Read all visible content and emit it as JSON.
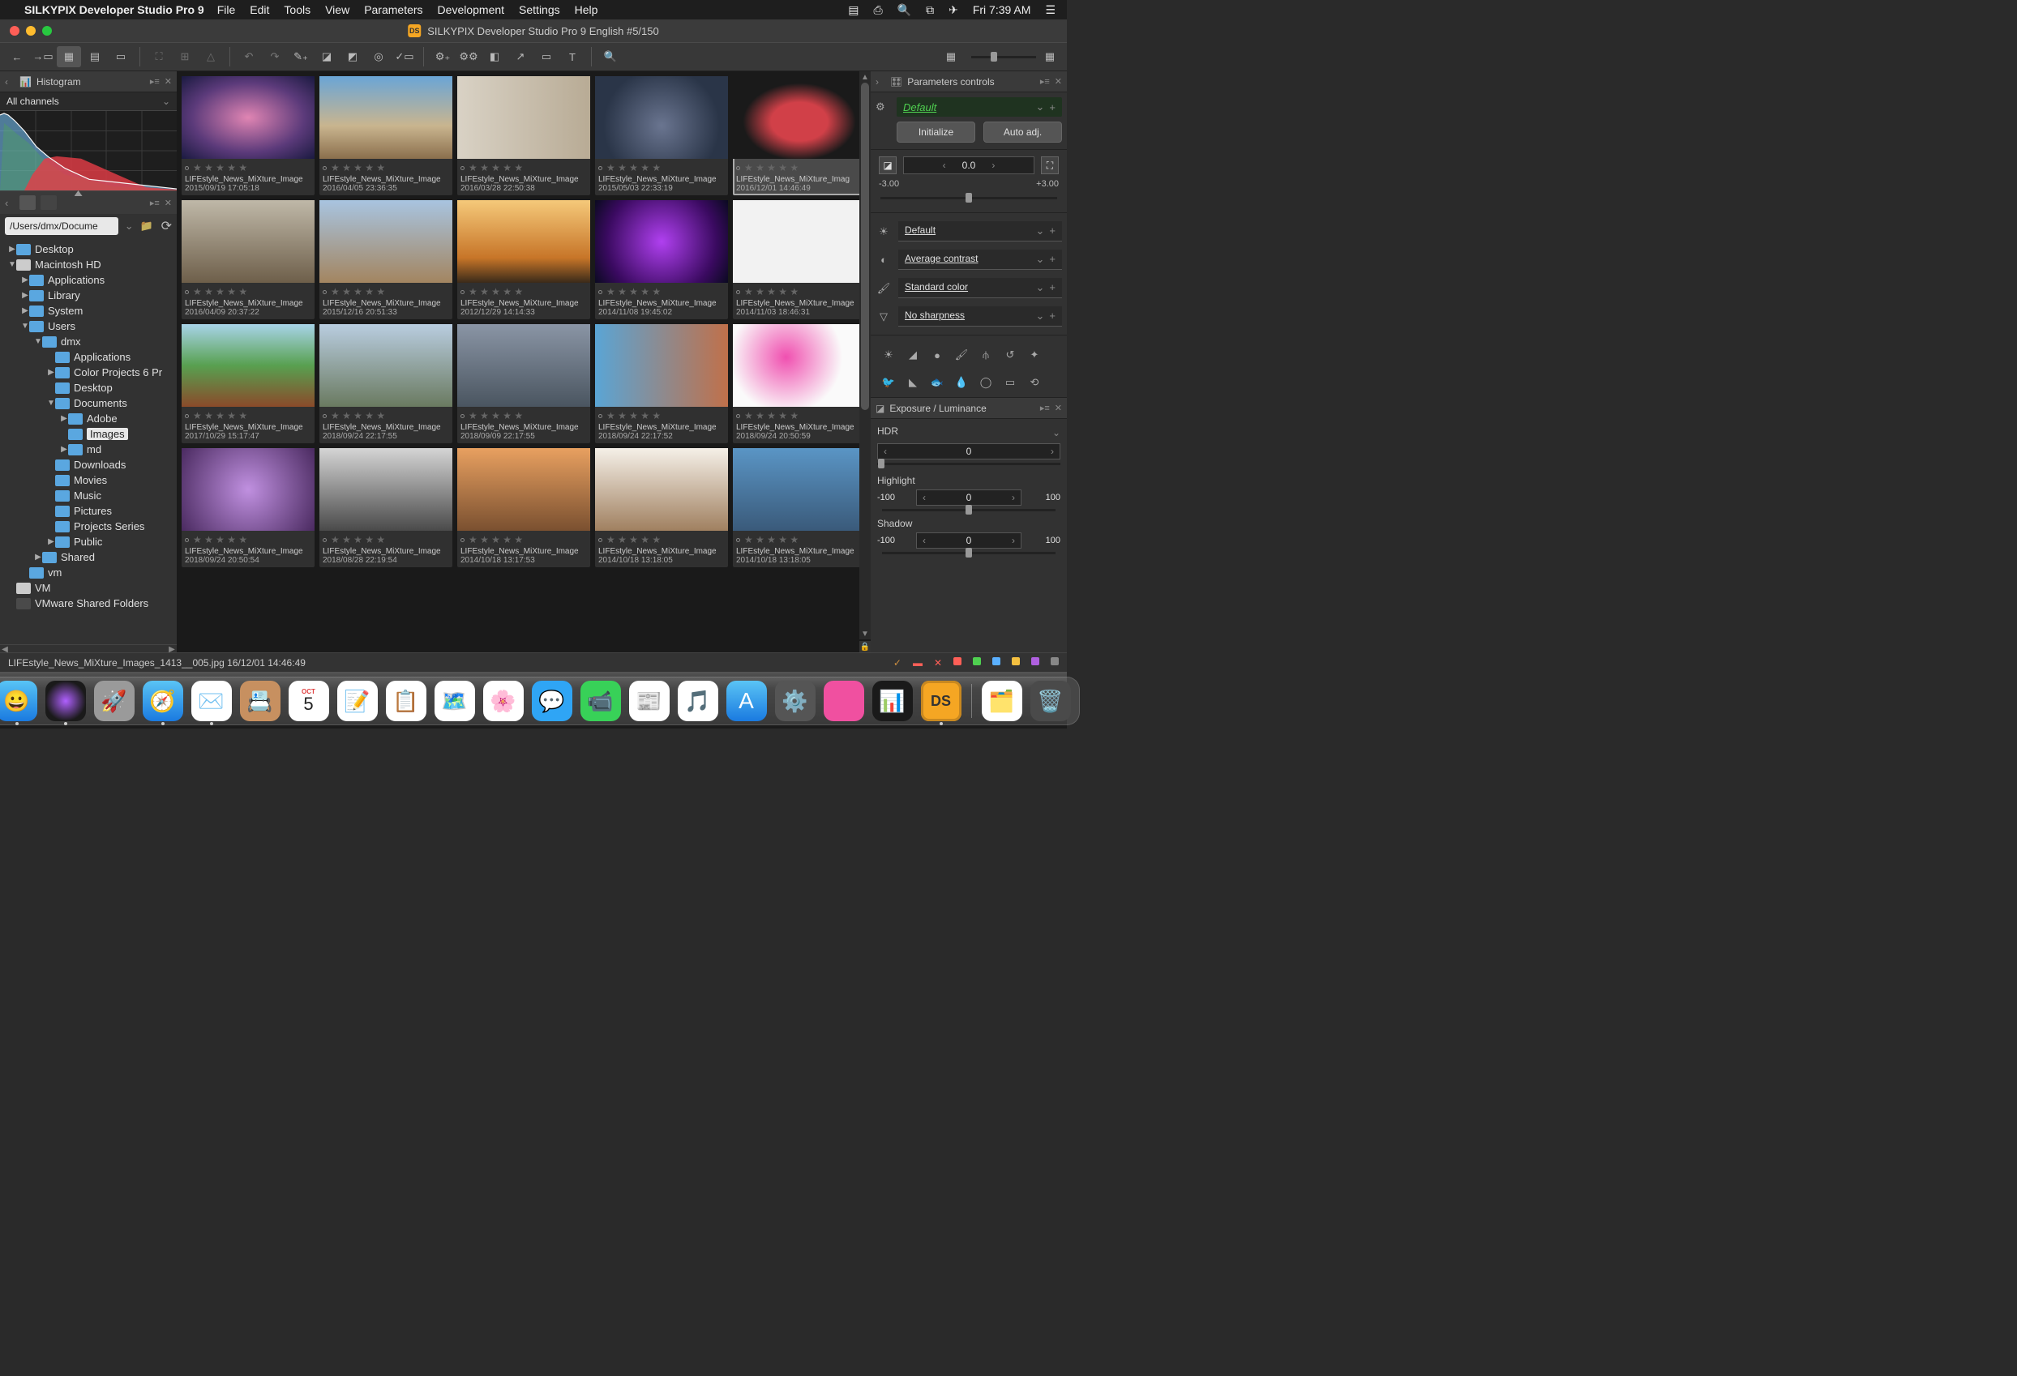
{
  "menubar": {
    "app_name": "SILKYPIX Developer Studio Pro 9",
    "menus": [
      "File",
      "Edit",
      "Tools",
      "View",
      "Parameters",
      "Development",
      "Settings",
      "Help"
    ],
    "clock": "Fri 7:39 AM"
  },
  "window": {
    "ds_badge": "DS",
    "title": "SILKYPIX Developer Studio Pro 9 English   #5/150"
  },
  "histogram": {
    "title": "Histogram",
    "channel": "All channels"
  },
  "browser": {
    "path": "/Users/dmx/Docume",
    "tree": [
      {
        "d": 0,
        "tri": "▶",
        "icon": "folder",
        "label": "Desktop"
      },
      {
        "d": 0,
        "tri": "▼",
        "icon": "hd",
        "label": "Macintosh HD"
      },
      {
        "d": 1,
        "tri": "▶",
        "icon": "folder",
        "label": "Applications"
      },
      {
        "d": 1,
        "tri": "▶",
        "icon": "folder",
        "label": "Library"
      },
      {
        "d": 1,
        "tri": "▶",
        "icon": "folder",
        "label": "System"
      },
      {
        "d": 1,
        "tri": "▼",
        "icon": "folder",
        "label": "Users"
      },
      {
        "d": 2,
        "tri": "▼",
        "icon": "folder",
        "label": "dmx"
      },
      {
        "d": 3,
        "tri": "",
        "icon": "folder",
        "label": "Applications"
      },
      {
        "d": 3,
        "tri": "▶",
        "icon": "folder",
        "label": "Color Projects 6 Pr"
      },
      {
        "d": 3,
        "tri": "",
        "icon": "folder",
        "label": "Desktop"
      },
      {
        "d": 3,
        "tri": "▼",
        "icon": "folder",
        "label": "Documents"
      },
      {
        "d": 4,
        "tri": "▶",
        "icon": "folder",
        "label": "Adobe"
      },
      {
        "d": 4,
        "tri": "",
        "icon": "folder",
        "label": "Images",
        "sel": true
      },
      {
        "d": 4,
        "tri": "▶",
        "icon": "folder",
        "label": "md"
      },
      {
        "d": 3,
        "tri": "",
        "icon": "folder",
        "label": "Downloads"
      },
      {
        "d": 3,
        "tri": "",
        "icon": "folder",
        "label": "Movies"
      },
      {
        "d": 3,
        "tri": "",
        "icon": "folder",
        "label": "Music"
      },
      {
        "d": 3,
        "tri": "",
        "icon": "folder",
        "label": "Pictures"
      },
      {
        "d": 3,
        "tri": "",
        "icon": "folder",
        "label": "Projects Series"
      },
      {
        "d": 3,
        "tri": "▶",
        "icon": "folder",
        "label": "Public"
      },
      {
        "d": 2,
        "tri": "▶",
        "icon": "folder",
        "label": "Shared"
      },
      {
        "d": 1,
        "tri": "",
        "icon": "folder",
        "label": "vm"
      },
      {
        "d": 0,
        "tri": "",
        "icon": "hd",
        "label": "VM"
      },
      {
        "d": 0,
        "tri": "",
        "icon": "dark",
        "label": "VMware Shared Folders"
      }
    ]
  },
  "thumbs": [
    {
      "g": "g1",
      "name": "LIFEstyle_News_MiXture_Image",
      "date": "2015/09/19 17:05:18"
    },
    {
      "g": "g2",
      "name": "LIFEstyle_News_MiXture_Image",
      "date": "2016/04/05 23:36:35"
    },
    {
      "g": "g3",
      "name": "LIFEstyle_News_MiXture_Image",
      "date": "2016/03/28 22:50:38"
    },
    {
      "g": "g4",
      "name": "LIFEstyle_News_MiXture_Image",
      "date": "2015/05/03 22:33:19"
    },
    {
      "g": "g5",
      "name": "LIFEstyle_News_MiXture_Imag",
      "date": "2016/12/01 14:46:49",
      "sel": true
    },
    {
      "g": "g6",
      "name": "LIFEstyle_News_MiXture_Image",
      "date": "2016/04/09 20:37:22"
    },
    {
      "g": "g7",
      "name": "LIFEstyle_News_MiXture_Image",
      "date": "2015/12/16 20:51:33"
    },
    {
      "g": "g8",
      "name": "LIFEstyle_News_MiXture_Image",
      "date": "2012/12/29 14:14:33"
    },
    {
      "g": "g9",
      "name": "LIFEstyle_News_MiXture_Image",
      "date": "2014/11/08 19:45:02"
    },
    {
      "g": "g10",
      "name": "LIFEstyle_News_MiXture_Image",
      "date": "2014/11/03 18:46:31"
    },
    {
      "g": "g11",
      "name": "LIFEstyle_News_MiXture_Image",
      "date": "2017/10/29 15:17:47"
    },
    {
      "g": "g12",
      "name": "LIFEstyle_News_MiXture_Image",
      "date": "2018/09/24 22:17:55"
    },
    {
      "g": "g13",
      "name": "LIFEstyle_News_MiXture_Image",
      "date": "2018/09/09 22:17:55"
    },
    {
      "g": "g14",
      "name": "LIFEstyle_News_MiXture_Image",
      "date": "2018/09/24 22:17:52"
    },
    {
      "g": "g15",
      "name": "LIFEstyle_News_MiXture_Image",
      "date": "2018/09/24 20:50:59"
    },
    {
      "g": "g16",
      "name": "LIFEstyle_News_MiXture_Image",
      "date": "2018/09/24 20:50:54"
    },
    {
      "g": "g17",
      "name": "LIFEstyle_News_MiXture_Image",
      "date": "2018/08/28 22:19:54"
    },
    {
      "g": "g18",
      "name": "LIFEstyle_News_MiXture_Image",
      "date": "2014/10/18 13:17:53"
    },
    {
      "g": "g19",
      "name": "LIFEstyle_News_MiXture_Image",
      "date": "2014/10/18 13:18:05"
    },
    {
      "g": "g20",
      "name": "LIFEstyle_News_MiXture_Image",
      "date": "2014/10/18 13:18:05"
    }
  ],
  "params": {
    "title": "Parameters controls",
    "preset": "Default",
    "initialize": "Initialize",
    "auto_adj": "Auto adj.",
    "exp_value": "0.0",
    "exp_min": "-3.00",
    "exp_max": "+3.00",
    "wb": "Default",
    "tone": "Average contrast",
    "color": "Standard color",
    "sharp": "No sharpness"
  },
  "exposure": {
    "title": "Exposure / Luminance",
    "hdr": "HDR",
    "hdr_val": "0",
    "highlight": "Highlight",
    "hl_min": "-100",
    "hl_val": "0",
    "hl_max": "100",
    "shadow": "Shadow",
    "sh_min": "-100",
    "sh_val": "0",
    "sh_max": "100"
  },
  "status": {
    "text": "LIFEstyle_News_MiXture_Images_1413__005.jpg 16/12/01 14:46:49",
    "colors": [
      "#ff5f57",
      "#4fd050",
      "#5ab0ff",
      "#f5c040",
      "#b060e0",
      "#888"
    ]
  },
  "dock": [
    {
      "bg": "linear-gradient(#58c4f5,#1a7ae0)",
      "emoji": "😀",
      "name": "finder",
      "run": true
    },
    {
      "bg": "radial-gradient(circle,#b060ff,#1a1a1a 70%)",
      "emoji": "",
      "name": "siri",
      "run": true
    },
    {
      "bg": "#9a9a9a",
      "emoji": "🚀",
      "name": "launchpad"
    },
    {
      "bg": "linear-gradient(#5ac4f5,#1a7ae0)",
      "emoji": "🧭",
      "name": "safari",
      "run": true
    },
    {
      "bg": "#fff",
      "emoji": "✉️",
      "name": "mail",
      "run": true
    },
    {
      "bg": "#c79060",
      "emoji": "📇",
      "name": "contacts"
    },
    {
      "bg": "#fff",
      "emoji": "",
      "name": "calendar"
    },
    {
      "bg": "#fff",
      "emoji": "📝",
      "name": "notes"
    },
    {
      "bg": "#fff",
      "emoji": "📋",
      "name": "reminders"
    },
    {
      "bg": "#fff",
      "emoji": "🗺️",
      "name": "maps"
    },
    {
      "bg": "#fff",
      "emoji": "🌸",
      "name": "photos"
    },
    {
      "bg": "#2fa5f5",
      "emoji": "💬",
      "name": "messages"
    },
    {
      "bg": "#38d158",
      "emoji": "📹",
      "name": "facetime"
    },
    {
      "bg": "#fff",
      "emoji": "📰",
      "name": "news"
    },
    {
      "bg": "#fff",
      "emoji": "🎵",
      "name": "itunes"
    },
    {
      "bg": "linear-gradient(#5ac4f5,#1a7ae0)",
      "emoji": "A",
      "name": "appstore"
    },
    {
      "bg": "#555",
      "emoji": "⚙️",
      "name": "settings"
    },
    {
      "bg": "#f050a0",
      "emoji": "",
      "name": "cleanmymac"
    },
    {
      "bg": "#1a1a1a",
      "emoji": "📊",
      "name": "activity"
    },
    {
      "bg": "#f5a623",
      "emoji": "DS",
      "name": "silkypix",
      "run": true
    },
    {
      "bg": "#fff",
      "emoji": "🗂️",
      "name": "folder"
    },
    {
      "bg": "#4a4a4a",
      "emoji": "🗑️",
      "name": "trash"
    }
  ],
  "calendar_day": "5",
  "calendar_month": "OCT"
}
